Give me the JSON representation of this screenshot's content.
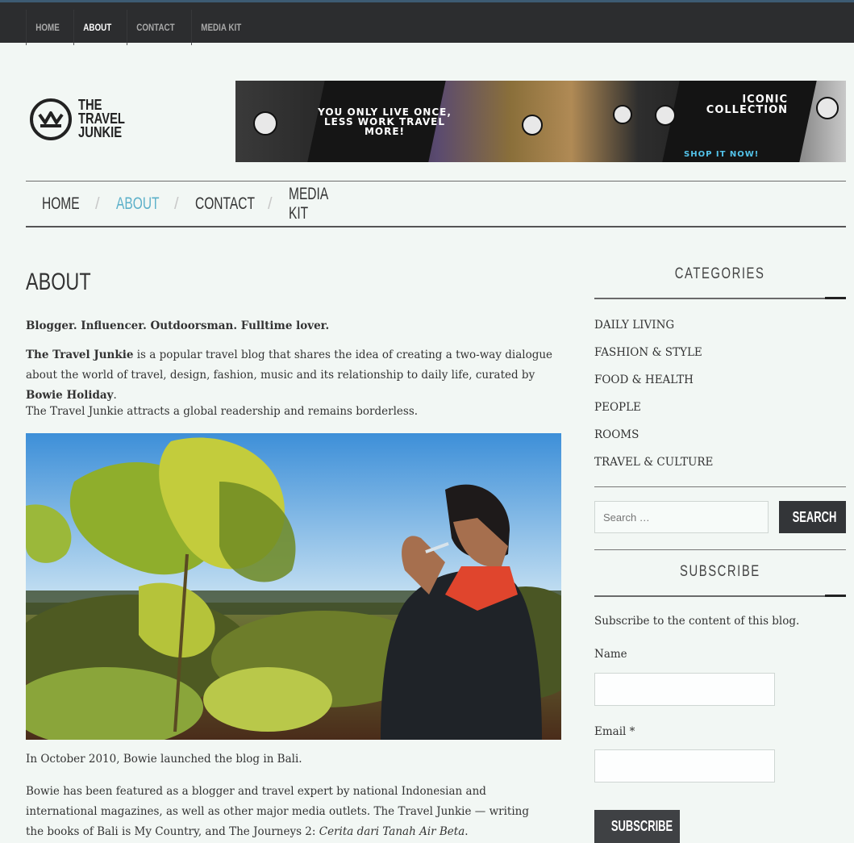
{
  "topbar": {
    "nav": [
      "HOME",
      "ABOUT",
      "CONTACT",
      "MEDIA KIT"
    ],
    "active": "ABOUT"
  },
  "logo": {
    "line1": "THE",
    "line2": "TRAVEL",
    "line3": "JUNKIE"
  },
  "banner": {
    "tagline_left": "YOU ONLY LIVE ONCE, LESS WORK TRAVEL MORE!",
    "tagline_right": "ICONIC COLLECTION",
    "cta": "SHOP IT NOW!"
  },
  "mainnav": {
    "items": [
      "HOME",
      "ABOUT",
      "CONTACT",
      "MEDIA KIT"
    ],
    "separator": "/",
    "active": "ABOUT"
  },
  "page": {
    "title": "ABOUT",
    "intro": "Blogger. Influencer. Outdoorsman. Fulltime lover.",
    "para1_bold": "The Travel Junkie",
    "para1_rest": " is a popular travel blog that shares the idea of creating a two-way dialogue about the world of travel, design, fashion, music and its relationship to daily life, curated by ",
    "para1_name": "Bowie Holiday",
    "para1_end": ".",
    "para2": "The Travel Junkie attracts a global readership and remains borderless.",
    "caption": "In October 2010, Bowie launched the blog in Bali.",
    "para3_main": "Bowie has been featured as a blogger and travel expert by national Indonesian and international magazines, as well as other major media outlets. The Travel Junkie — writing the books of Bali is My Country, and The Journeys 2: ",
    "para3_italic": "Cerita dari Tanah Air Beta",
    "para3_end": "."
  },
  "sidebar": {
    "categories_title": "CATEGORIES",
    "categories": [
      "DAILY LIVING",
      "FASHION & STYLE",
      "FOOD & HEALTH",
      "PEOPLE",
      "ROOMS",
      "TRAVEL & CULTURE"
    ],
    "search_placeholder": "Search …",
    "search_button": "SEARCH",
    "subscribe_title": "SUBSCRIBE",
    "subscribe_desc": "Subscribe to the content of this blog.",
    "name_label": "Name",
    "email_label": "Email *",
    "subscribe_button": "SUBSCRIBE"
  }
}
